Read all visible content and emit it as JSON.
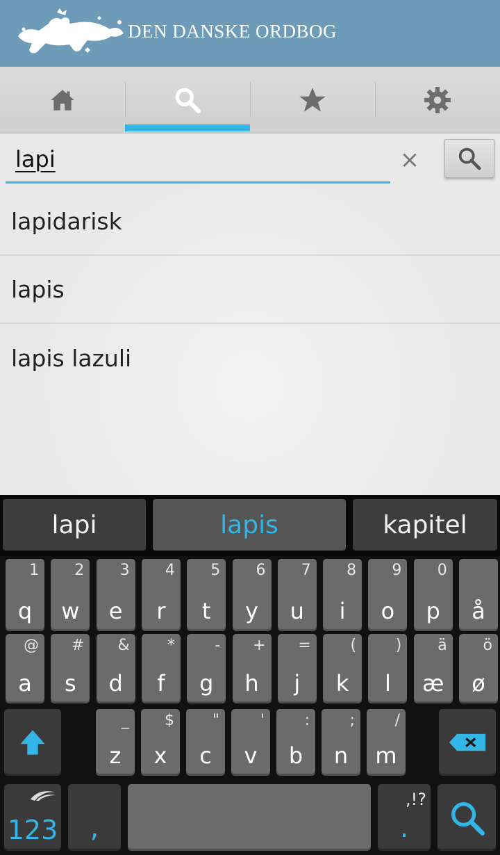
{
  "header": {
    "title": "DEN DANSKE ORDBOG"
  },
  "tabs": [
    {
      "icon": "home-icon"
    },
    {
      "icon": "search-icon",
      "active": true
    },
    {
      "icon": "star-icon"
    },
    {
      "icon": "gear-icon"
    }
  ],
  "search": {
    "value": "lapi",
    "clear_glyph": "×"
  },
  "results": [
    "lapidarisk",
    "lapis",
    "lapis lazuli"
  ],
  "keyboard": {
    "suggestions": [
      "lapi",
      "lapis",
      "kapitel"
    ],
    "row1": [
      {
        "main": "q",
        "alt": "1"
      },
      {
        "main": "w",
        "alt": "2"
      },
      {
        "main": "e",
        "alt": "3"
      },
      {
        "main": "r",
        "alt": "4"
      },
      {
        "main": "t",
        "alt": "5"
      },
      {
        "main": "y",
        "alt": "6"
      },
      {
        "main": "u",
        "alt": "7"
      },
      {
        "main": "i",
        "alt": "8"
      },
      {
        "main": "o",
        "alt": "9"
      },
      {
        "main": "p",
        "alt": "0"
      },
      {
        "main": "å",
        "alt": ""
      }
    ],
    "row2": [
      {
        "main": "a",
        "alt": "@"
      },
      {
        "main": "s",
        "alt": "#"
      },
      {
        "main": "d",
        "alt": "&"
      },
      {
        "main": "f",
        "alt": "*"
      },
      {
        "main": "g",
        "alt": "-"
      },
      {
        "main": "h",
        "alt": "+"
      },
      {
        "main": "j",
        "alt": "="
      },
      {
        "main": "k",
        "alt": "("
      },
      {
        "main": "l",
        "alt": ")"
      },
      {
        "main": "æ",
        "alt": "ä"
      },
      {
        "main": "ø",
        "alt": "ö"
      }
    ],
    "row3": [
      {
        "main": "z",
        "alt": "_"
      },
      {
        "main": "x",
        "alt": "$"
      },
      {
        "main": "c",
        "alt": "\""
      },
      {
        "main": "v",
        "alt": "'"
      },
      {
        "main": "b",
        "alt": ":"
      },
      {
        "main": "n",
        "alt": ";"
      },
      {
        "main": "m",
        "alt": "/"
      }
    ],
    "numbers_label": "123",
    "comma_label": ",",
    "period_label": ".",
    "period_alt": ",!?",
    "accent_color": "#33b5e5"
  }
}
